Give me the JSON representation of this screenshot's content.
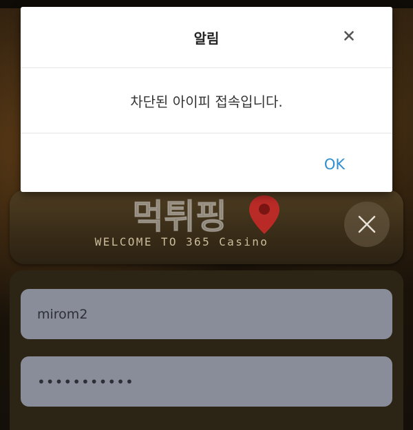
{
  "dialog": {
    "title": "알림",
    "message": "차단된 아이피 접속입니다.",
    "ok_label": "OK",
    "close_icon": "close-icon"
  },
  "login": {
    "welcome": "WELCOME TO 365 Casino",
    "username_value": "mirom2",
    "password_value": "•••••••••••",
    "close_icon": "close-icon"
  },
  "watermark": {
    "text": "먹튀핑"
  },
  "colors": {
    "ok_blue": "#2f8fd0",
    "field_bg": "#888d99",
    "panel_gold": "#4e3d22",
    "pin_red": "#c62a28"
  }
}
